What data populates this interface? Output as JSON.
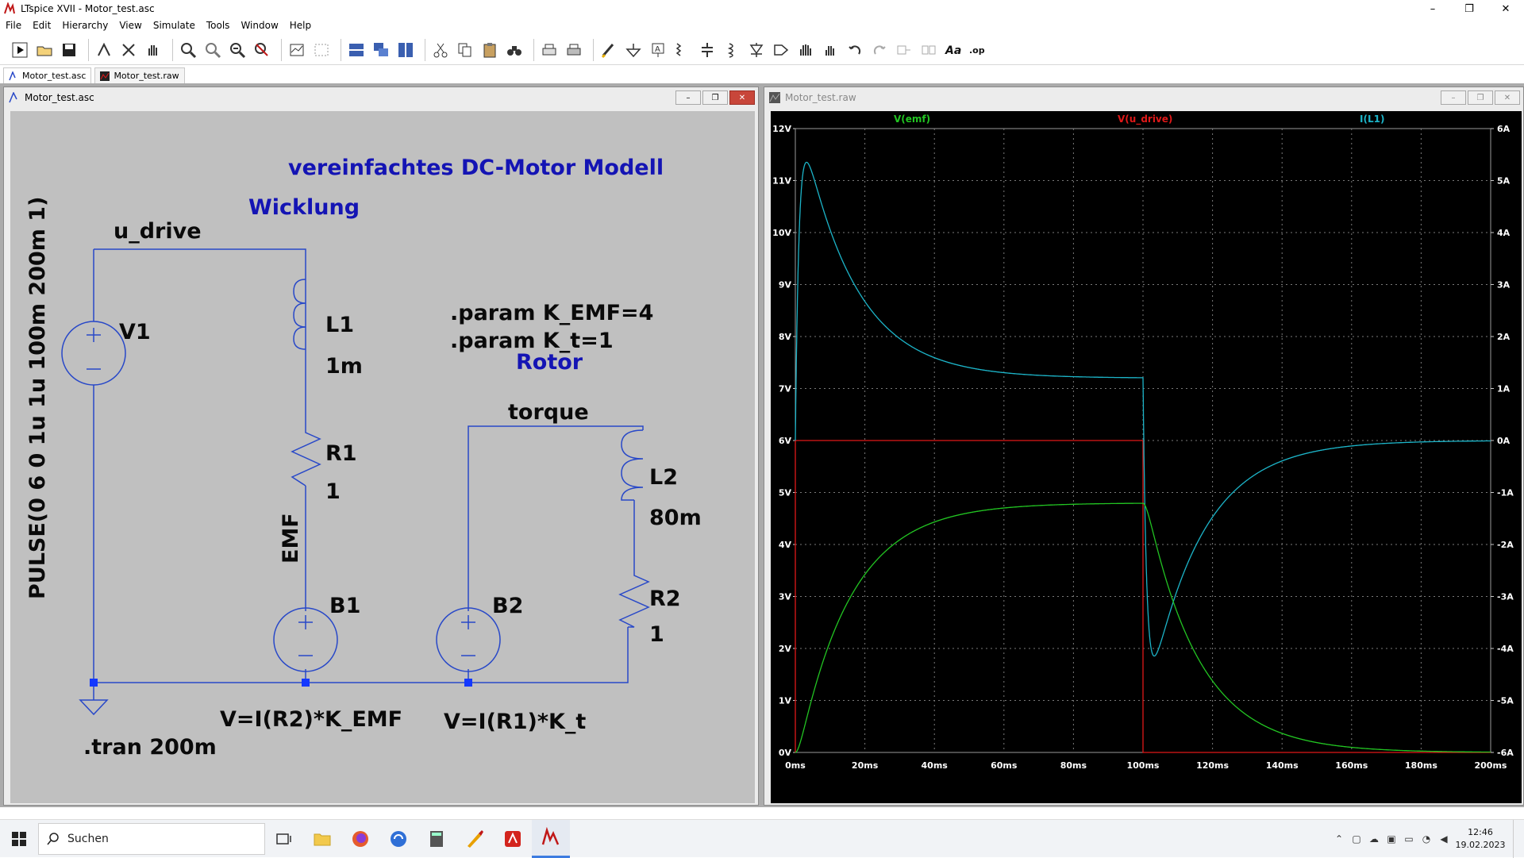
{
  "window": {
    "title": "LTspice XVII - Motor_test.asc",
    "min": "–",
    "max": "❐",
    "close": "✕"
  },
  "menu": [
    "File",
    "Edit",
    "Hierarchy",
    "View",
    "Simulate",
    "Tools",
    "Window",
    "Help"
  ],
  "toolbar": {
    "op_label": ".op",
    "aa_label": "Aa"
  },
  "doc_tabs": [
    {
      "label": "Motor_test.asc",
      "active": true
    },
    {
      "label": "Motor_test.raw",
      "active": false
    }
  ],
  "schematic": {
    "title": "Motor_test.asc",
    "heading": "vereinfachtes DC-Motor Modell",
    "section_winding": "Wicklung",
    "section_rotor": "Rotor",
    "net_u_drive": "u_drive",
    "net_torque": "torque",
    "net_emf": "EMF",
    "pulse": "PULSE(0 6 0 1u 1u 100m 200m 1)",
    "param1": ".param K_EMF=4",
    "param2": ".param K_t=1",
    "tran": ".tran 200m",
    "v1": "V1",
    "l1": "L1",
    "l1_val": "1m",
    "r1": "R1",
    "r1_val": "1",
    "l2": "L2",
    "l2_val": "80m",
    "r2": "R2",
    "r2_val": "1",
    "b1": "B1",
    "b1_expr": "V=I(R2)*K_EMF",
    "b2": "B2",
    "b2_expr": "V=I(R1)*K_t",
    "colors": {
      "wire": "#2848c8",
      "label": "#0a0a0a",
      "heading": "#1414b4",
      "node": "#1438ff"
    }
  },
  "waveform": {
    "title": "Motor_test.raw",
    "traces": [
      {
        "name": "V(emf)",
        "color": "#22c422"
      },
      {
        "name": "V(u_drive)",
        "color": "#e01818"
      },
      {
        "name": "I(L1)",
        "color": "#1cb4c8"
      }
    ],
    "left_ticks": [
      "0V",
      "1V",
      "2V",
      "3V",
      "4V",
      "5V",
      "6V",
      "7V",
      "8V",
      "9V",
      "10V",
      "11V",
      "12V"
    ],
    "right_ticks": [
      "-6A",
      "-5A",
      "-4A",
      "-3A",
      "-2A",
      "-1A",
      "0A",
      "1A",
      "2A",
      "3A",
      "4A",
      "5A",
      "6A"
    ],
    "x_ticks": [
      "0ms",
      "20ms",
      "40ms",
      "60ms",
      "80ms",
      "100ms",
      "120ms",
      "140ms",
      "160ms",
      "180ms",
      "200ms"
    ]
  },
  "taskbar": {
    "search_placeholder": "Suchen",
    "time": "12:46",
    "date": "19.02.2023"
  }
}
